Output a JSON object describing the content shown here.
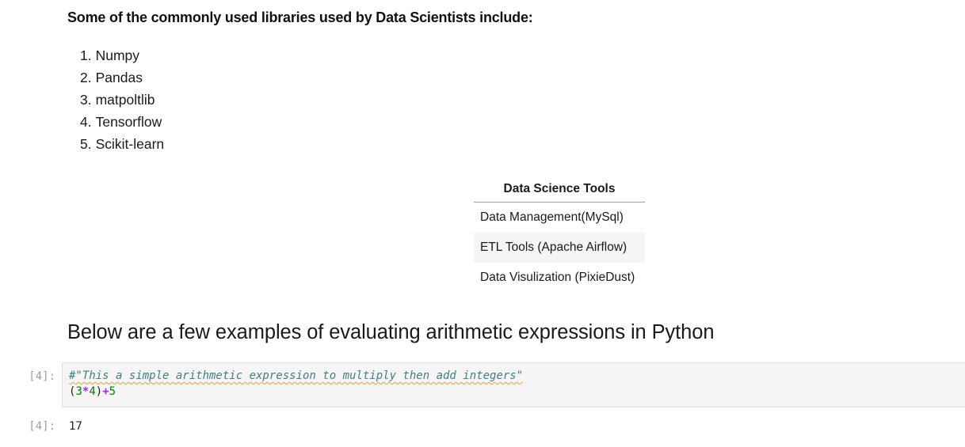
{
  "markdown_intro": {
    "text": "Some of the commonly used libraries used by Data Scientists include:"
  },
  "libraries": [
    {
      "number": "1.",
      "name": "Numpy"
    },
    {
      "number": "2.",
      "name": "Pandas"
    },
    {
      "number": "3.",
      "name": "matpoltlib"
    },
    {
      "number": "4.",
      "name": "Tensorflow"
    },
    {
      "number": "5.",
      "name": "Scikit-learn"
    }
  ],
  "tools_table": {
    "header": "Data Science Tools",
    "rows": [
      "Data Management(MySql)",
      "ETL Tools (Apache Airflow)",
      "Data Visulization (PixieDust)"
    ]
  },
  "section_heading": "Below are a few examples of evaluating arithmetic expressions in Python",
  "code_cell": {
    "prompt": "[4]:",
    "comment": "#\"This a simple arithmetic expression to multiply then add integers\"",
    "tokens": {
      "open_paren": "(",
      "num1": "3",
      "op_mul": "*",
      "num2": "4",
      "close_paren": ")",
      "op_add": "+",
      "num3": "5"
    }
  },
  "output_cell": {
    "prompt": "[4]:",
    "value": "17"
  },
  "colors": {
    "comment": "#408080",
    "number": "#008000",
    "operator": "#aa22ff",
    "prompt": "#9e9e9e",
    "cell_background": "#f5f5f5"
  }
}
